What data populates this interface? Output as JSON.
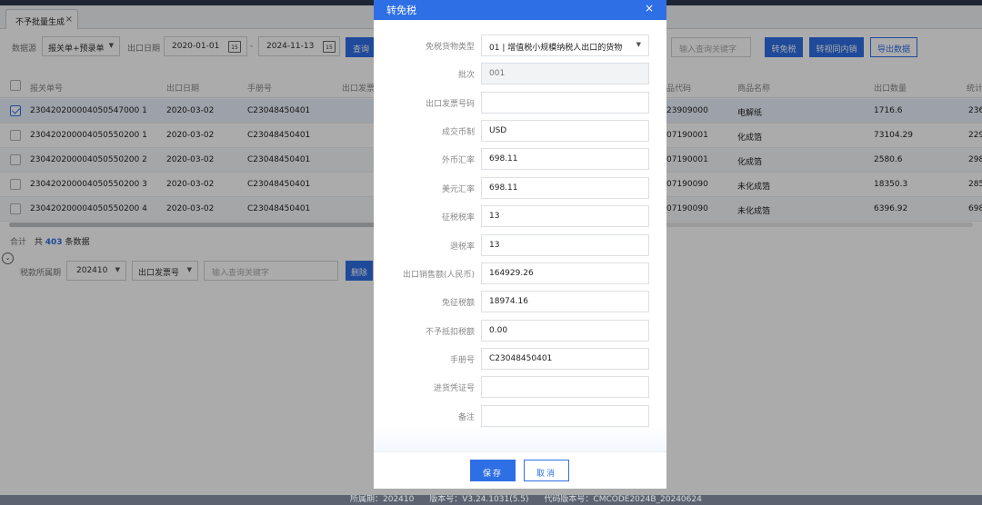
{
  "tab": {
    "label": "不予批量生成",
    "close": "×"
  },
  "toolbar": {
    "datasource_label": "数据源",
    "datasource_value": "报关单+预录单",
    "date_label": "出口日期",
    "date_from": "2020-01-01",
    "date_sep": "-",
    "date_to": "2024-11-13",
    "cal_icon_text": "15",
    "query_btn": "查询",
    "search_placeholder": "输入查询关键字",
    "to_taxfree_btn": "转免税",
    "to_return_btn": "转视同内销",
    "export_btn": "导出数据"
  },
  "table": {
    "headers": {
      "col1": "报关单号",
      "col2": "出口日期",
      "col3": "手册号",
      "col4": "出口发票",
      "col5": "品代码",
      "col6": "商品名称",
      "col7": "出口数量",
      "col8": "统计"
    },
    "rows": [
      {
        "no": "230420200004050547000 1",
        "date": "2020-03-02",
        "manual": "C23048450401",
        "code": "23909000",
        "name": "电解纸",
        "qty": "1716.6",
        "stat": "236",
        "checked": true
      },
      {
        "no": "230420200004050550200 1",
        "date": "2020-03-02",
        "manual": "C23048450401",
        "code": "07190001",
        "name": "化成箔",
        "qty": "73104.29",
        "stat": "229",
        "checked": false
      },
      {
        "no": "230420200004050550200 2",
        "date": "2020-03-02",
        "manual": "C23048450401",
        "code": "07190001",
        "name": "化成箔",
        "qty": "2580.6",
        "stat": "298",
        "checked": false
      },
      {
        "no": "230420200004050550200 3",
        "date": "2020-03-02",
        "manual": "C23048450401",
        "code": "07190090",
        "name": "未化成箔",
        "qty": "18350.3",
        "stat": "285",
        "checked": false
      },
      {
        "no": "230420200004050550200 4",
        "date": "2020-03-02",
        "manual": "C23048450401",
        "code": "07190090",
        "name": "未化成箔",
        "qty": "6396.92",
        "stat": "698",
        "checked": false
      }
    ]
  },
  "summary": {
    "prefix": "合计",
    "gong": "共",
    "count": "403",
    "suffix": "条数据"
  },
  "lower": {
    "period_label": "税款所属期",
    "period_value": "202410",
    "field_value": "出口发票号",
    "search_placeholder": "输入查询关键字",
    "delete_btn": "删除",
    "collapse_icon": "⌄"
  },
  "modal": {
    "title": "转免税",
    "close": "×",
    "fields": [
      {
        "label": "免税货物类型",
        "value": "01 | 增值税小规模纳税人出口的货物"
      },
      {
        "label": "批次",
        "value": "001"
      },
      {
        "label": "出口发票号码",
        "value": ""
      },
      {
        "label": "成交币制",
        "value": "USD"
      },
      {
        "label": "外币汇率",
        "value": "698.11"
      },
      {
        "label": "美元汇率",
        "value": "698.11"
      },
      {
        "label": "征税税率",
        "value": "13"
      },
      {
        "label": "退税率",
        "value": "13"
      },
      {
        "label": "出口销售额(人民币)",
        "value": "164929.26"
      },
      {
        "label": "免征税额",
        "value": "18974.16"
      },
      {
        "label": "不予抵扣税额",
        "value": "0.00"
      },
      {
        "label": "手册号",
        "value": "C23048450401"
      },
      {
        "label": "进货凭证号",
        "value": ""
      },
      {
        "label": "备注",
        "value": ""
      }
    ],
    "save_btn": "保存",
    "cancel_btn": "取消"
  },
  "footer": {
    "period": "所属期：202410",
    "version": "版本号：V3.24.1031(5.5)",
    "code_version": "代码版本号：CMCODE2024B_20240624"
  }
}
